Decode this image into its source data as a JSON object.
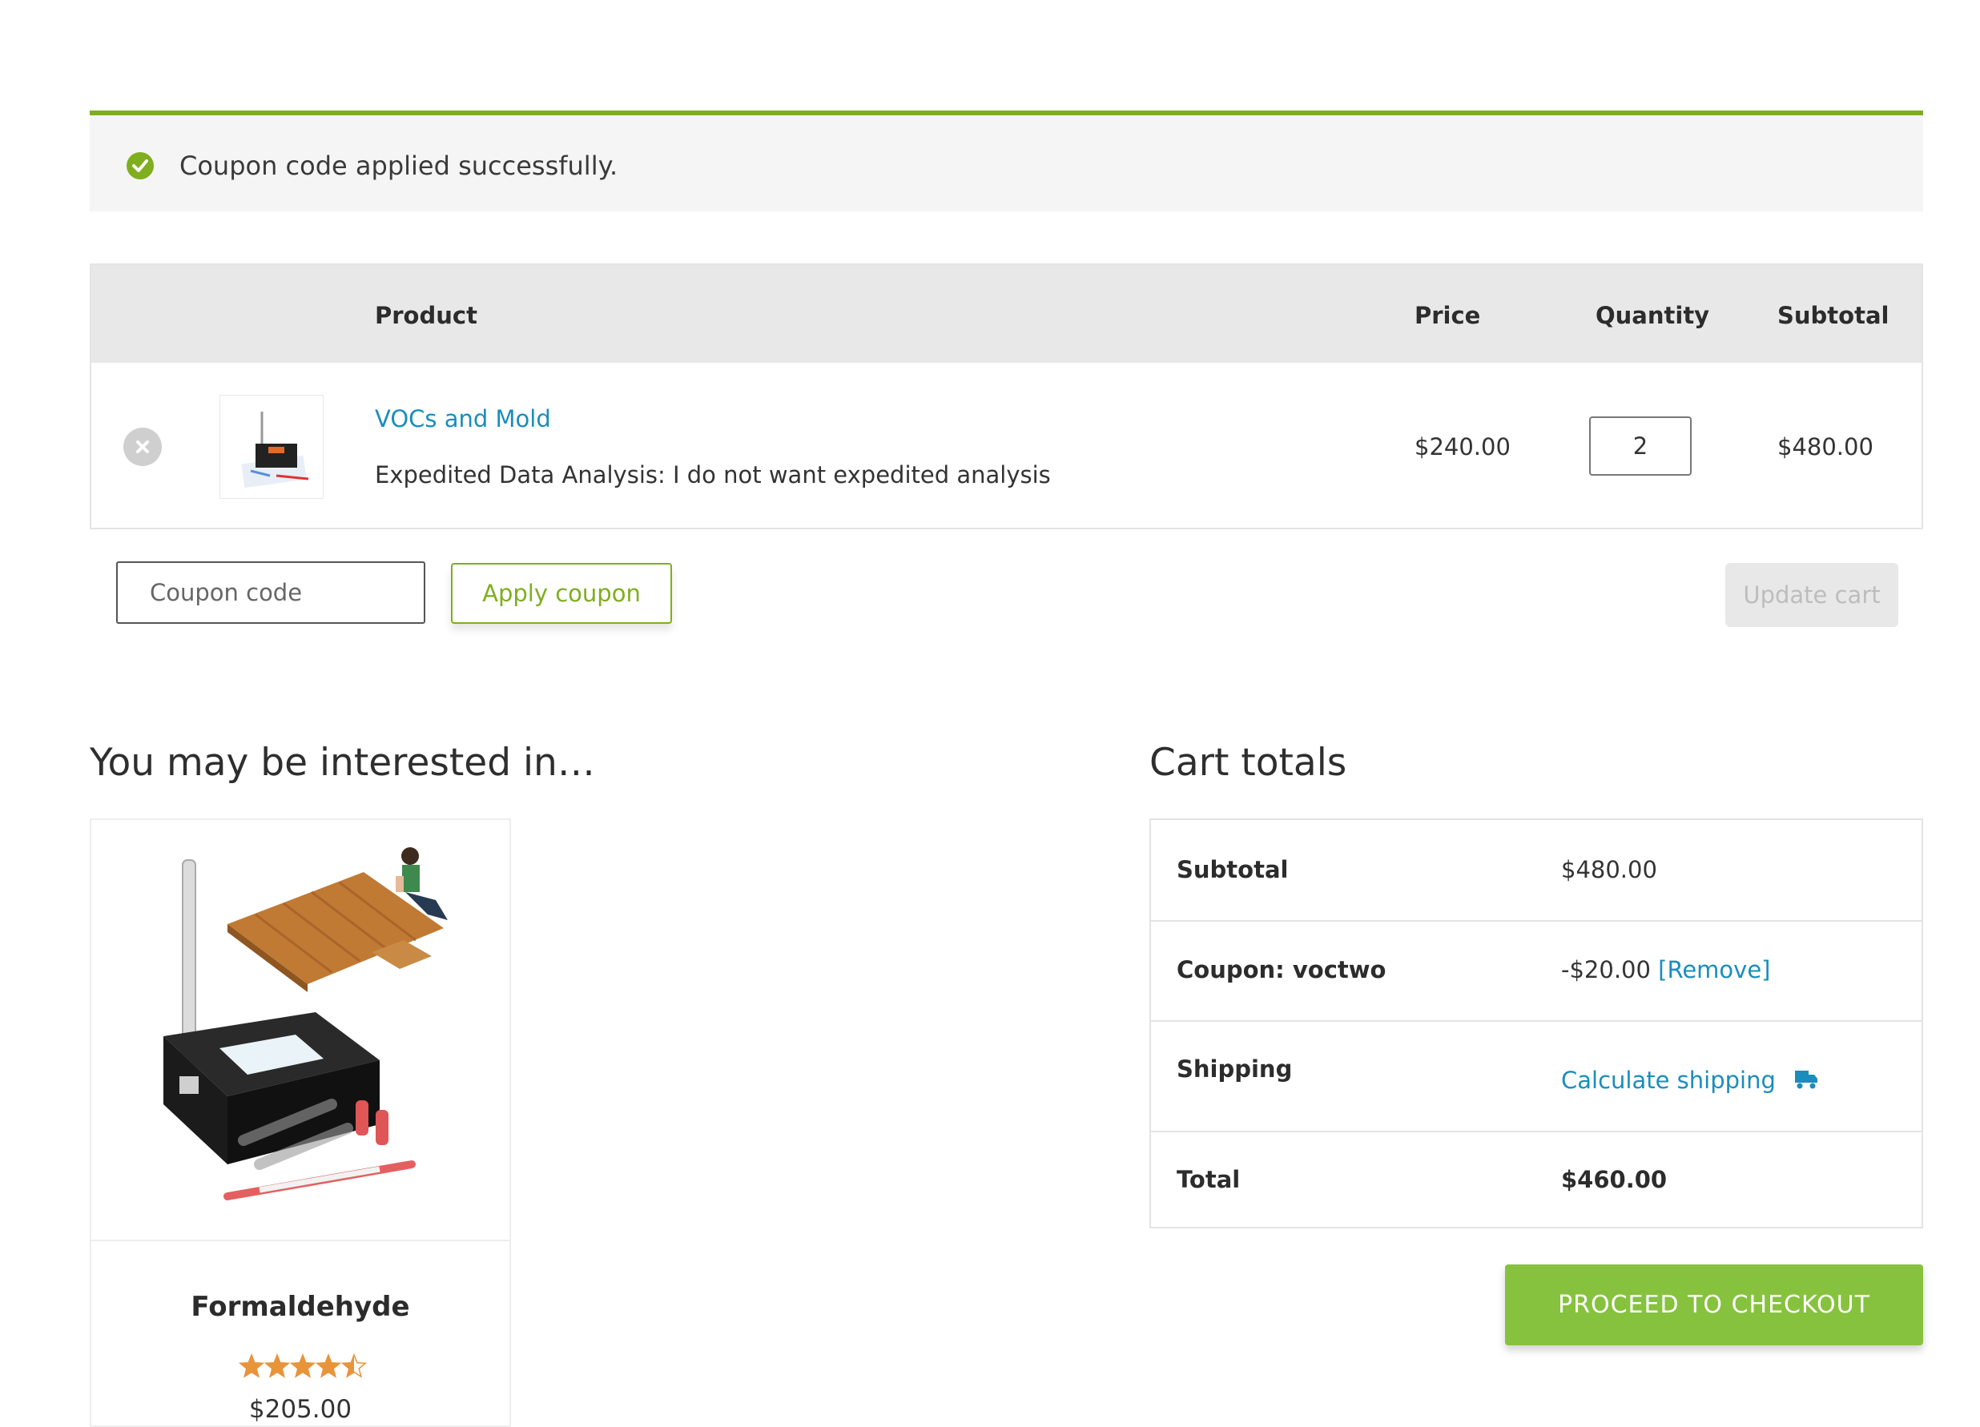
{
  "notice": {
    "message": "Coupon code applied successfully.",
    "icon": "check-circle-icon",
    "accent": "#7fae1e"
  },
  "cart": {
    "headers": {
      "product": "Product",
      "price": "Price",
      "quantity": "Quantity",
      "subtotal": "Subtotal"
    },
    "items": [
      {
        "name": "VOCs and Mold",
        "meta_key": "Expedited Data Analysis:",
        "meta_value": "I do not want expedited analysis",
        "price": "$240.00",
        "quantity": "2",
        "subtotal": "$480.00"
      }
    ],
    "coupon_placeholder": "Coupon code",
    "apply_label": "Apply coupon",
    "update_label": "Update cart"
  },
  "crosssell": {
    "title": "You may be interested in…",
    "product": {
      "name": "Formaldehyde",
      "rating": 4.5,
      "rating_max": 5,
      "price": "$205.00"
    }
  },
  "totals": {
    "title": "Cart totals",
    "subtotal_label": "Subtotal",
    "subtotal_value": "$480.00",
    "coupon_label": "Coupon: voctwo",
    "coupon_value": "-$20.00",
    "coupon_remove": "[Remove]",
    "shipping_label": "Shipping",
    "shipping_link": "Calculate shipping",
    "total_label": "Total",
    "total_value": "$460.00",
    "checkout_label": "PROCEED TO CHECKOUT"
  },
  "colors": {
    "brand_green": "#86c23e",
    "link_blue": "#1a8dbd",
    "star_orange": "#e8943a"
  }
}
